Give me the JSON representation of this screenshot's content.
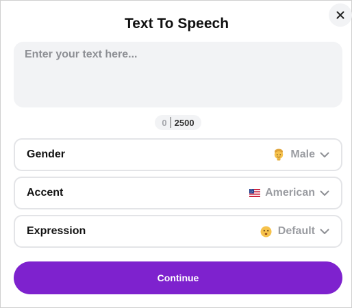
{
  "dialog": {
    "title": "Text To Speech",
    "close_icon": "close-icon"
  },
  "text_input": {
    "placeholder": "Enter your text here...",
    "value": ""
  },
  "counter": {
    "current": "0",
    "limit": "2500"
  },
  "options": {
    "gender": {
      "label": "Gender",
      "value": "Male",
      "icon": "man-emoji-icon"
    },
    "accent": {
      "label": "Accent",
      "value": "American",
      "icon": "us-flag-icon"
    },
    "expression": {
      "label": "Expression",
      "value": "Default",
      "icon": "neutral-face-icon"
    }
  },
  "continue_label": "Continue",
  "colors": {
    "accent": "#7e22ce",
    "input_bg": "#f2f3f5",
    "muted_text": "#9a9ca1"
  }
}
